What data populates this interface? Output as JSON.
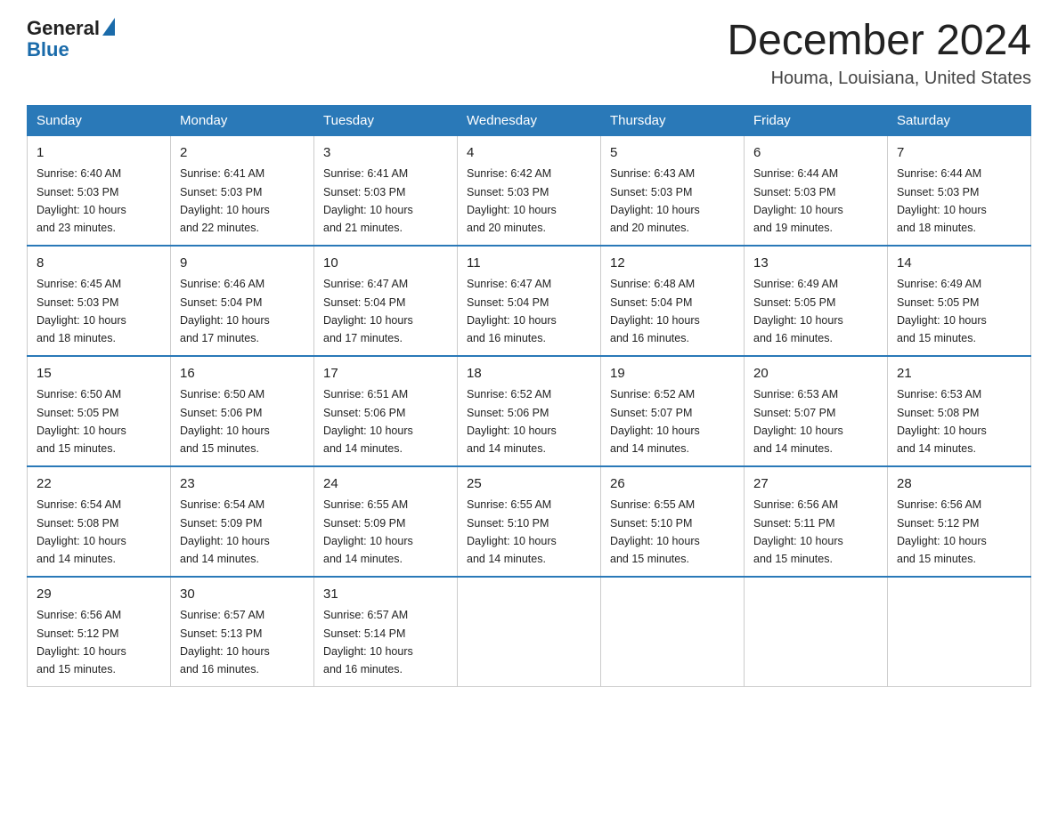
{
  "logo": {
    "general": "General",
    "blue": "Blue"
  },
  "header": {
    "month": "December 2024",
    "location": "Houma, Louisiana, United States"
  },
  "days_of_week": [
    "Sunday",
    "Monday",
    "Tuesday",
    "Wednesday",
    "Thursday",
    "Friday",
    "Saturday"
  ],
  "weeks": [
    [
      {
        "day": "1",
        "sunrise": "6:40 AM",
        "sunset": "5:03 PM",
        "daylight": "10 hours and 23 minutes."
      },
      {
        "day": "2",
        "sunrise": "6:41 AM",
        "sunset": "5:03 PM",
        "daylight": "10 hours and 22 minutes."
      },
      {
        "day": "3",
        "sunrise": "6:41 AM",
        "sunset": "5:03 PM",
        "daylight": "10 hours and 21 minutes."
      },
      {
        "day": "4",
        "sunrise": "6:42 AM",
        "sunset": "5:03 PM",
        "daylight": "10 hours and 20 minutes."
      },
      {
        "day": "5",
        "sunrise": "6:43 AM",
        "sunset": "5:03 PM",
        "daylight": "10 hours and 20 minutes."
      },
      {
        "day": "6",
        "sunrise": "6:44 AM",
        "sunset": "5:03 PM",
        "daylight": "10 hours and 19 minutes."
      },
      {
        "day": "7",
        "sunrise": "6:44 AM",
        "sunset": "5:03 PM",
        "daylight": "10 hours and 18 minutes."
      }
    ],
    [
      {
        "day": "8",
        "sunrise": "6:45 AM",
        "sunset": "5:03 PM",
        "daylight": "10 hours and 18 minutes."
      },
      {
        "day": "9",
        "sunrise": "6:46 AM",
        "sunset": "5:04 PM",
        "daylight": "10 hours and 17 minutes."
      },
      {
        "day": "10",
        "sunrise": "6:47 AM",
        "sunset": "5:04 PM",
        "daylight": "10 hours and 17 minutes."
      },
      {
        "day": "11",
        "sunrise": "6:47 AM",
        "sunset": "5:04 PM",
        "daylight": "10 hours and 16 minutes."
      },
      {
        "day": "12",
        "sunrise": "6:48 AM",
        "sunset": "5:04 PM",
        "daylight": "10 hours and 16 minutes."
      },
      {
        "day": "13",
        "sunrise": "6:49 AM",
        "sunset": "5:05 PM",
        "daylight": "10 hours and 16 minutes."
      },
      {
        "day": "14",
        "sunrise": "6:49 AM",
        "sunset": "5:05 PM",
        "daylight": "10 hours and 15 minutes."
      }
    ],
    [
      {
        "day": "15",
        "sunrise": "6:50 AM",
        "sunset": "5:05 PM",
        "daylight": "10 hours and 15 minutes."
      },
      {
        "day": "16",
        "sunrise": "6:50 AM",
        "sunset": "5:06 PM",
        "daylight": "10 hours and 15 minutes."
      },
      {
        "day": "17",
        "sunrise": "6:51 AM",
        "sunset": "5:06 PM",
        "daylight": "10 hours and 14 minutes."
      },
      {
        "day": "18",
        "sunrise": "6:52 AM",
        "sunset": "5:06 PM",
        "daylight": "10 hours and 14 minutes."
      },
      {
        "day": "19",
        "sunrise": "6:52 AM",
        "sunset": "5:07 PM",
        "daylight": "10 hours and 14 minutes."
      },
      {
        "day": "20",
        "sunrise": "6:53 AM",
        "sunset": "5:07 PM",
        "daylight": "10 hours and 14 minutes."
      },
      {
        "day": "21",
        "sunrise": "6:53 AM",
        "sunset": "5:08 PM",
        "daylight": "10 hours and 14 minutes."
      }
    ],
    [
      {
        "day": "22",
        "sunrise": "6:54 AM",
        "sunset": "5:08 PM",
        "daylight": "10 hours and 14 minutes."
      },
      {
        "day": "23",
        "sunrise": "6:54 AM",
        "sunset": "5:09 PM",
        "daylight": "10 hours and 14 minutes."
      },
      {
        "day": "24",
        "sunrise": "6:55 AM",
        "sunset": "5:09 PM",
        "daylight": "10 hours and 14 minutes."
      },
      {
        "day": "25",
        "sunrise": "6:55 AM",
        "sunset": "5:10 PM",
        "daylight": "10 hours and 14 minutes."
      },
      {
        "day": "26",
        "sunrise": "6:55 AM",
        "sunset": "5:10 PM",
        "daylight": "10 hours and 15 minutes."
      },
      {
        "day": "27",
        "sunrise": "6:56 AM",
        "sunset": "5:11 PM",
        "daylight": "10 hours and 15 minutes."
      },
      {
        "day": "28",
        "sunrise": "6:56 AM",
        "sunset": "5:12 PM",
        "daylight": "10 hours and 15 minutes."
      }
    ],
    [
      {
        "day": "29",
        "sunrise": "6:56 AM",
        "sunset": "5:12 PM",
        "daylight": "10 hours and 15 minutes."
      },
      {
        "day": "30",
        "sunrise": "6:57 AM",
        "sunset": "5:13 PM",
        "daylight": "10 hours and 16 minutes."
      },
      {
        "day": "31",
        "sunrise": "6:57 AM",
        "sunset": "5:14 PM",
        "daylight": "10 hours and 16 minutes."
      },
      null,
      null,
      null,
      null
    ]
  ],
  "labels": {
    "sunrise": "Sunrise:",
    "sunset": "Sunset:",
    "daylight": "Daylight:"
  }
}
